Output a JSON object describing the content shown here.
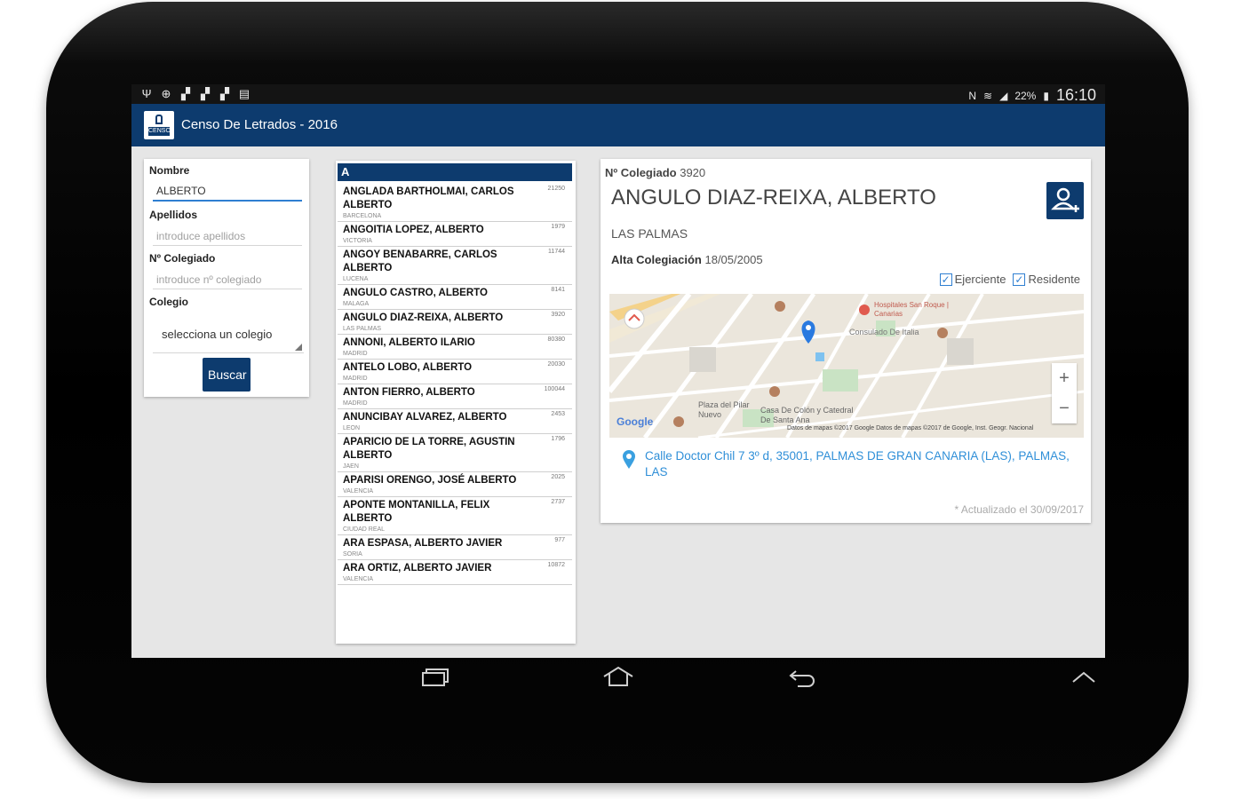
{
  "status_bar": {
    "left_icons": [
      "usb-icon",
      "android-icon",
      "file-icon",
      "file-icon",
      "file-icon",
      "clipboard-icon"
    ],
    "right_icons": [
      "nfc-icon",
      "wifi-icon",
      "signal-icon"
    ],
    "battery": "22%",
    "time": "16:10"
  },
  "app": {
    "title": "Censo De Letrados - 2016",
    "logo_text": "CENSO"
  },
  "search": {
    "nombre_label": "Nombre",
    "nombre_value": "ALBERTO",
    "apellidos_label": "Apellidos",
    "apellidos_placeholder": "introduce apellidos",
    "colegiado_label": "Nº Colegiado",
    "colegiado_placeholder": "introduce nº colegiado",
    "colegio_label": "Colegio",
    "colegio_value": "selecciona un colegio",
    "button_label": "Buscar"
  },
  "list": {
    "header": "A",
    "rows": [
      {
        "name": "ANGLADA BARTHOLMAI, CARLOS ALBERTO",
        "num": "21250",
        "city": "BARCELONA"
      },
      {
        "name": "ANGOITIA LOPEZ, ALBERTO",
        "num": "1979",
        "city": "VICTORIA"
      },
      {
        "name": "ANGOY BENABARRE, CARLOS ALBERTO",
        "num": "11744",
        "city": "LUCENA"
      },
      {
        "name": "ANGULO CASTRO, ALBERTO",
        "num": "8141",
        "city": "MALAGA"
      },
      {
        "name": "ANGULO DIAZ-REIXA, ALBERTO",
        "num": "3920",
        "city": "LAS PALMAS"
      },
      {
        "name": "ANNONI, ALBERTO ILARIO",
        "num": "80380",
        "city": "MADRID"
      },
      {
        "name": "ANTELO LOBO, ALBERTO",
        "num": "20030",
        "city": "MADRID"
      },
      {
        "name": "ANTON FIERRO, ALBERTO",
        "num": "100044",
        "city": "MADRID"
      },
      {
        "name": "ANUNCIBAY ALVAREZ, ALBERTO",
        "num": "2453",
        "city": "LEON"
      },
      {
        "name": "APARICIO DE LA TORRE, AGUSTIN ALBERTO",
        "num": "1796",
        "city": "JAEN"
      },
      {
        "name": "APARISI ORENGO, JOSÉ ALBERTO",
        "num": "2025",
        "city": "VALENCIA"
      },
      {
        "name": "APONTE MONTANILLA, FELIX ALBERTO",
        "num": "2737",
        "city": "CIUDAD REAL"
      },
      {
        "name": "ARA ESPASA, ALBERTO JAVIER",
        "num": "977",
        "city": "SORIA"
      },
      {
        "name": "ARA ORTIZ, ALBERTO JAVIER",
        "num": "10872",
        "city": "VALENCIA"
      }
    ]
  },
  "detail": {
    "num_label": "Nº Colegiado",
    "num_value": "3920",
    "name": "ANGULO DIAZ-REIXA, ALBERTO",
    "city": "LAS PALMAS",
    "alta_label": "Alta Colegiación",
    "alta_value": "18/05/2005",
    "ejerciente_label": "Ejerciente",
    "residente_label": "Residente",
    "address": "Calle Doctor Chil 7 3º d, 35001, PALMAS DE GRAN CANARIA (LAS), PALMAS, LAS",
    "updated": "* Actualizado el 30/09/2017"
  },
  "map": {
    "labels": {
      "hospital": "Hospitales San Roque | Canarias",
      "consulado": "Consulado De Italia",
      "plaza": "Plaza del Pilar Nuevo",
      "casa": "Casa De Colón y Catedral De Santa Ana",
      "google": "Google",
      "credits": "Datos de mapas ©2017 Google Datos de mapas ©2017 de Google, Inst. Geogr. Nacional"
    },
    "zoom_in": "+",
    "zoom_out": "−"
  },
  "nav": {
    "icons": [
      "recent-apps-icon",
      "home-icon",
      "back-icon",
      "chevron-up-icon"
    ]
  },
  "colors": {
    "primary": "#0d3b6e",
    "accent": "#2f7fd1"
  }
}
